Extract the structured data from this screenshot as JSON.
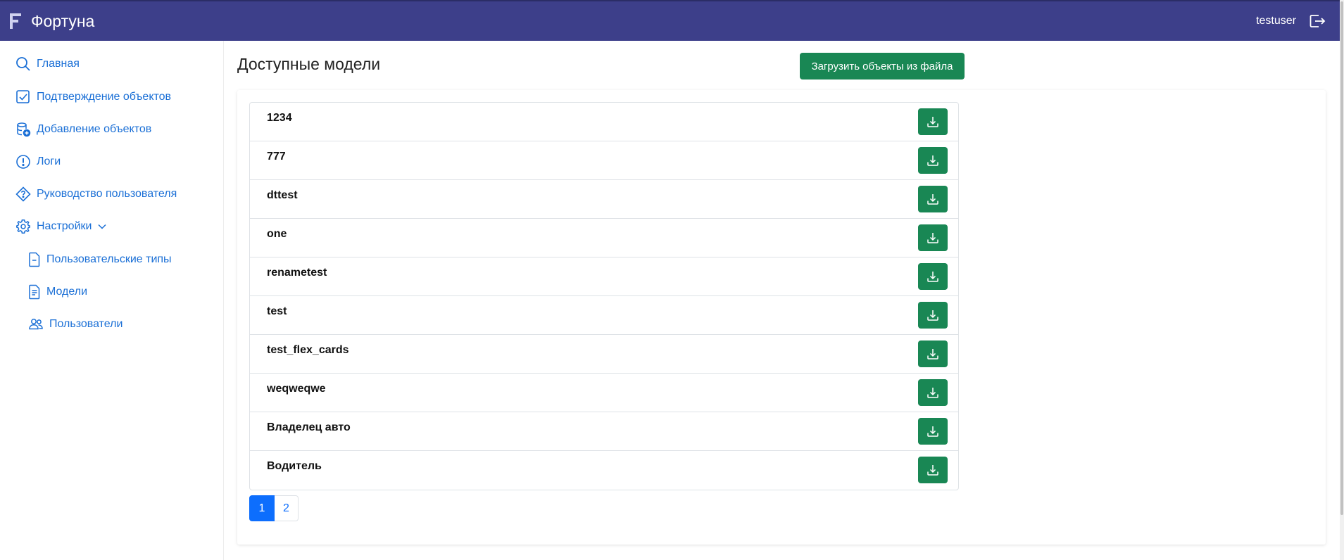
{
  "app": {
    "title": "Фортуна",
    "username": "testuser"
  },
  "sidebar": {
    "items": [
      {
        "label": "Главная",
        "icon": "search-icon"
      },
      {
        "label": "Подтверждение объектов",
        "icon": "checkbox-icon"
      },
      {
        "label": "Добавление объектов",
        "icon": "database-add-icon"
      },
      {
        "label": "Логи",
        "icon": "exclamation-circle-icon"
      },
      {
        "label": "Руководство пользователя",
        "icon": "question-diamond-icon"
      },
      {
        "label": "Настройки",
        "icon": "gear-icon"
      }
    ],
    "subitems": [
      {
        "label": "Пользовательские типы",
        "icon": "file-minus-icon"
      },
      {
        "label": "Модели",
        "icon": "file-text-icon"
      },
      {
        "label": "Пользователи",
        "icon": "people-icon"
      }
    ]
  },
  "main": {
    "title": "Доступные модели",
    "upload_label": "Загрузить объекты из файла",
    "models": [
      "1234",
      "777",
      "dttest",
      "one",
      "renametest",
      "test",
      "test_flex_cards",
      "weqweqwe",
      "Владелец авто",
      "Водитель"
    ],
    "pagination": [
      "1",
      "2"
    ],
    "current_page": "1"
  },
  "colors": {
    "header": "#3d3f8a",
    "accent": "#198754",
    "link": "#1a6fd6",
    "page_active": "#0d6efd"
  }
}
